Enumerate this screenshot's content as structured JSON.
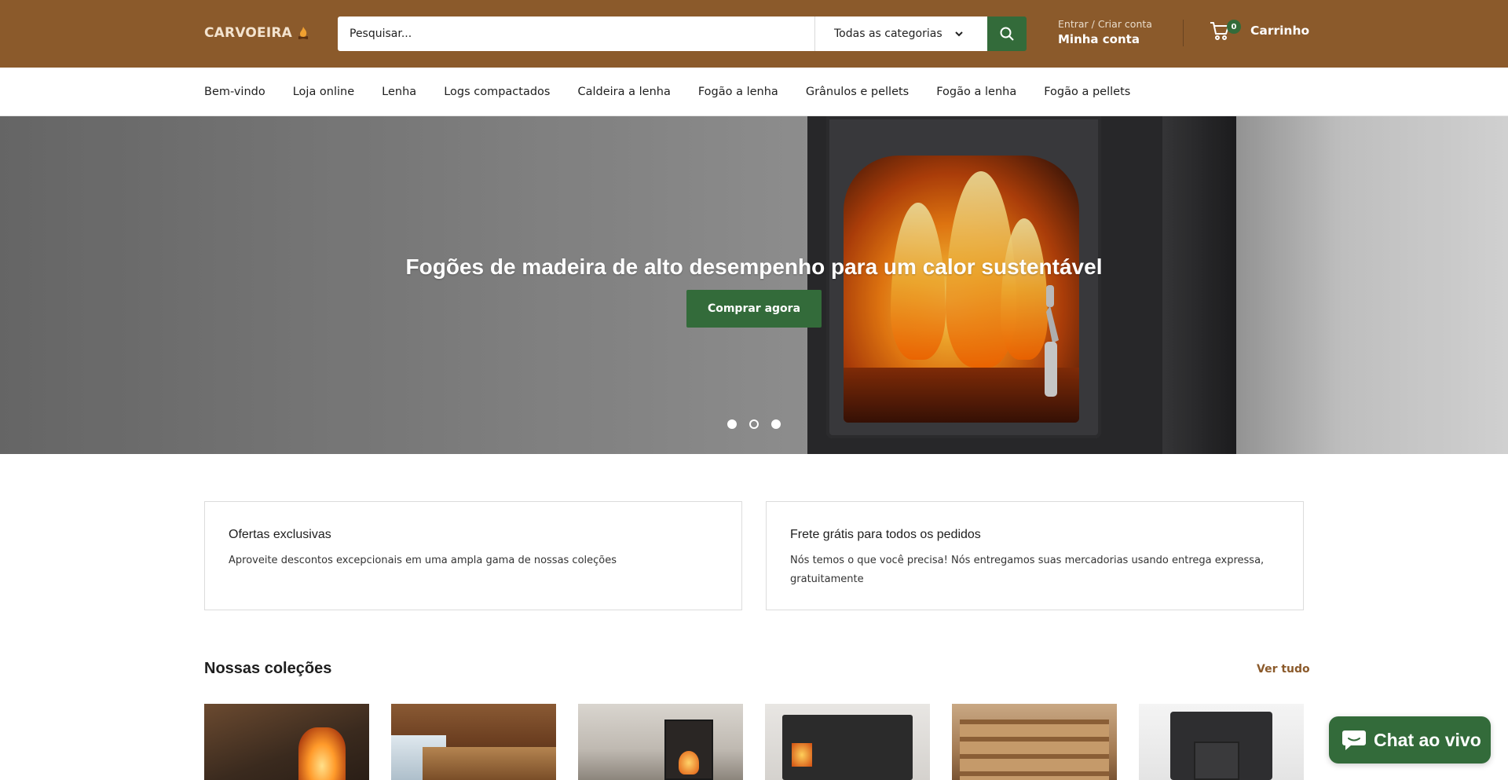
{
  "header": {
    "logo_text": "CARVOEIRA",
    "search_placeholder": "Pesquisar...",
    "category_select": "Todas as categorias",
    "account_small": "Entrar / Criar conta",
    "account_big": "Minha conta",
    "cart_count": "0",
    "cart_label": "Carrinho"
  },
  "nav": {
    "items": [
      "Bem-vindo",
      "Loja online",
      "Lenha",
      "Logs compactados",
      "Caldeira a lenha",
      "Fogão a lenha",
      "Grânulos e pellets",
      "Fogão a lenha",
      "Fogão a pellets"
    ]
  },
  "hero": {
    "title": "Fogões de madeira de alto desempenho para um calor sustentável",
    "button": "Comprar agora",
    "slide_count": 3,
    "active_slide": 2
  },
  "features": [
    {
      "title": "Ofertas exclusivas",
      "text": "Aproveite descontos excepcionais em uma ampla gama de nossas coleções"
    },
    {
      "title": "Frete grátis para todos os pedidos",
      "text": "Nós temos o que você precisa! Nós entregamos suas mercadorias usando entrega expressa, gratuitamente"
    }
  ],
  "collections": {
    "title": "Nossas coleções",
    "view_all": "Ver tudo"
  },
  "chat": {
    "label": "Chat ao vivo"
  },
  "colors": {
    "header_bg": "#8b5a2b",
    "accent_green": "#336b3a",
    "link_brown": "#8b5a2b"
  },
  "icons": {
    "search": "search-icon",
    "chevron": "chevron-down-icon",
    "cart": "cart-icon",
    "chat": "chat-bubble-icon",
    "logo": "flame-logo-icon"
  }
}
